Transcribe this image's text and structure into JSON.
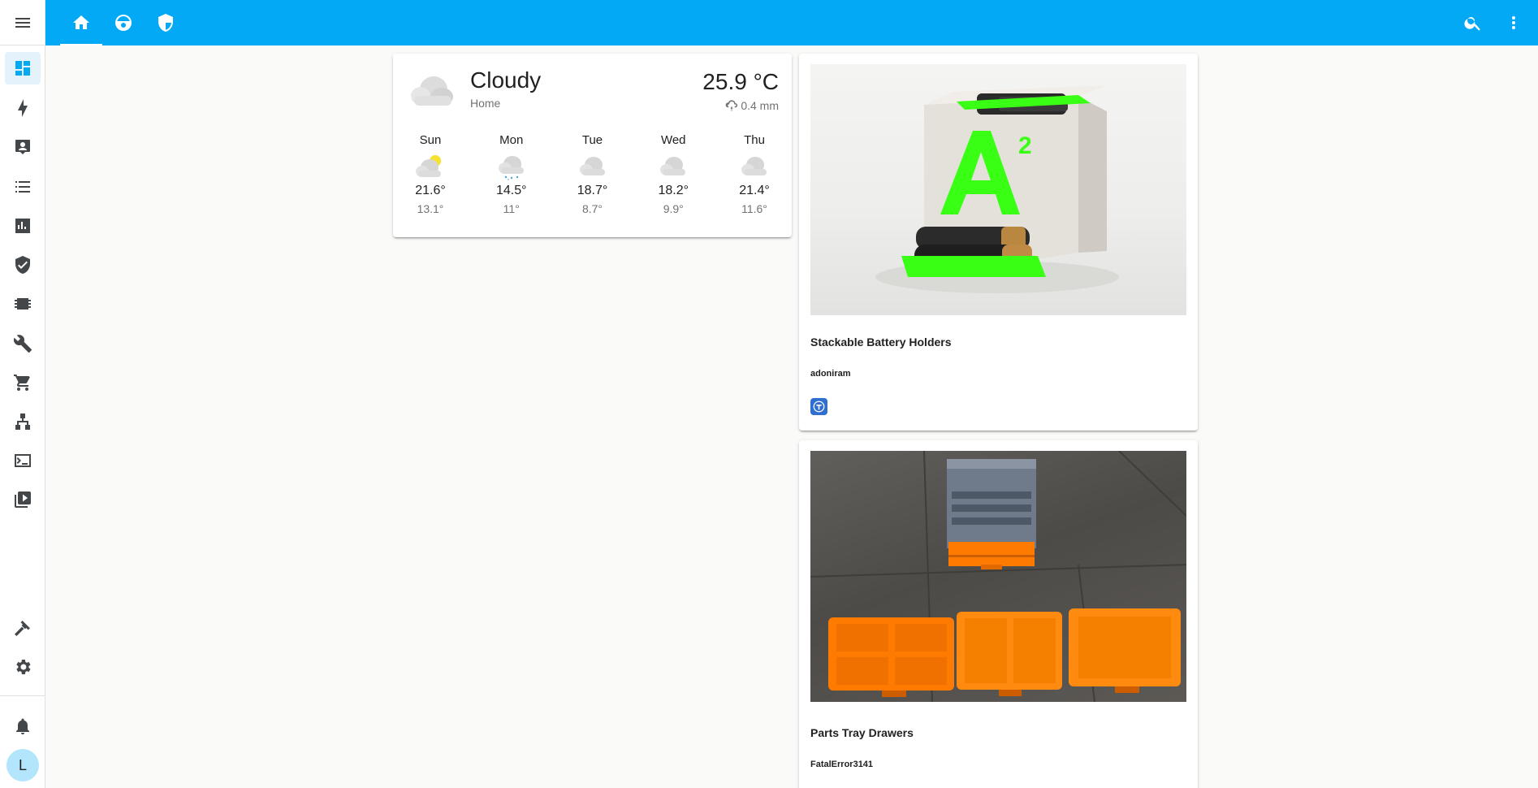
{
  "colors": {
    "header": "#03a9f4",
    "sidebar_active": "#03a9f4",
    "accent_green": "#39ff14",
    "accent_orange": "#ff7a00"
  },
  "sidebar": {
    "menu_icon": "menu-icon",
    "items": [
      {
        "name": "overview",
        "icon": "dashboard-icon",
        "active": true
      },
      {
        "name": "energy",
        "icon": "lightning-icon"
      },
      {
        "name": "contacts",
        "icon": "account-box-icon"
      },
      {
        "name": "logbook",
        "icon": "list-icon"
      },
      {
        "name": "history",
        "icon": "chart-bar-icon"
      },
      {
        "name": "security",
        "icon": "shield-check-icon"
      },
      {
        "name": "hardware",
        "icon": "chip-icon"
      },
      {
        "name": "tools",
        "icon": "wrench-icon"
      },
      {
        "name": "shopping",
        "icon": "cart-icon"
      },
      {
        "name": "network",
        "icon": "sitemap-icon"
      },
      {
        "name": "terminal",
        "icon": "terminal-icon"
      },
      {
        "name": "media",
        "icon": "play-box-icon"
      },
      {
        "name": "developer",
        "icon": "hammer-icon"
      },
      {
        "name": "settings",
        "icon": "gear-icon"
      },
      {
        "name": "notifications",
        "icon": "bell-icon"
      }
    ],
    "user_initial": "L"
  },
  "header": {
    "tabs": [
      {
        "icon": "home-icon",
        "active": true
      },
      {
        "icon": "robot-vacuum-icon"
      },
      {
        "icon": "shield-half-icon"
      }
    ],
    "search_icon": "search-icon",
    "more_icon": "dots-vertical-icon"
  },
  "weather": {
    "condition": "Cloudy",
    "location": "Home",
    "temperature": "25.9 °C",
    "precipitation": "0.4 mm",
    "forecast": [
      {
        "day": "Sun",
        "icon": "partly-cloudy-icon",
        "high": "21.6°",
        "low": "13.1°"
      },
      {
        "day": "Mon",
        "icon": "snowy-rainy-icon",
        "high": "14.5°",
        "low": "11°"
      },
      {
        "day": "Tue",
        "icon": "cloudy-icon",
        "high": "18.7°",
        "low": "8.7°"
      },
      {
        "day": "Wed",
        "icon": "cloudy-icon",
        "high": "18.2°",
        "low": "9.9°"
      },
      {
        "day": "Thu",
        "icon": "cloudy-icon",
        "high": "21.4°",
        "low": "11.6°"
      }
    ]
  },
  "projects": [
    {
      "title": "Stackable Battery Holders",
      "author": "adoniram",
      "badge_icon": "thingiverse-icon"
    },
    {
      "title": "Parts Tray Drawers",
      "author": "FatalError3141"
    }
  ]
}
